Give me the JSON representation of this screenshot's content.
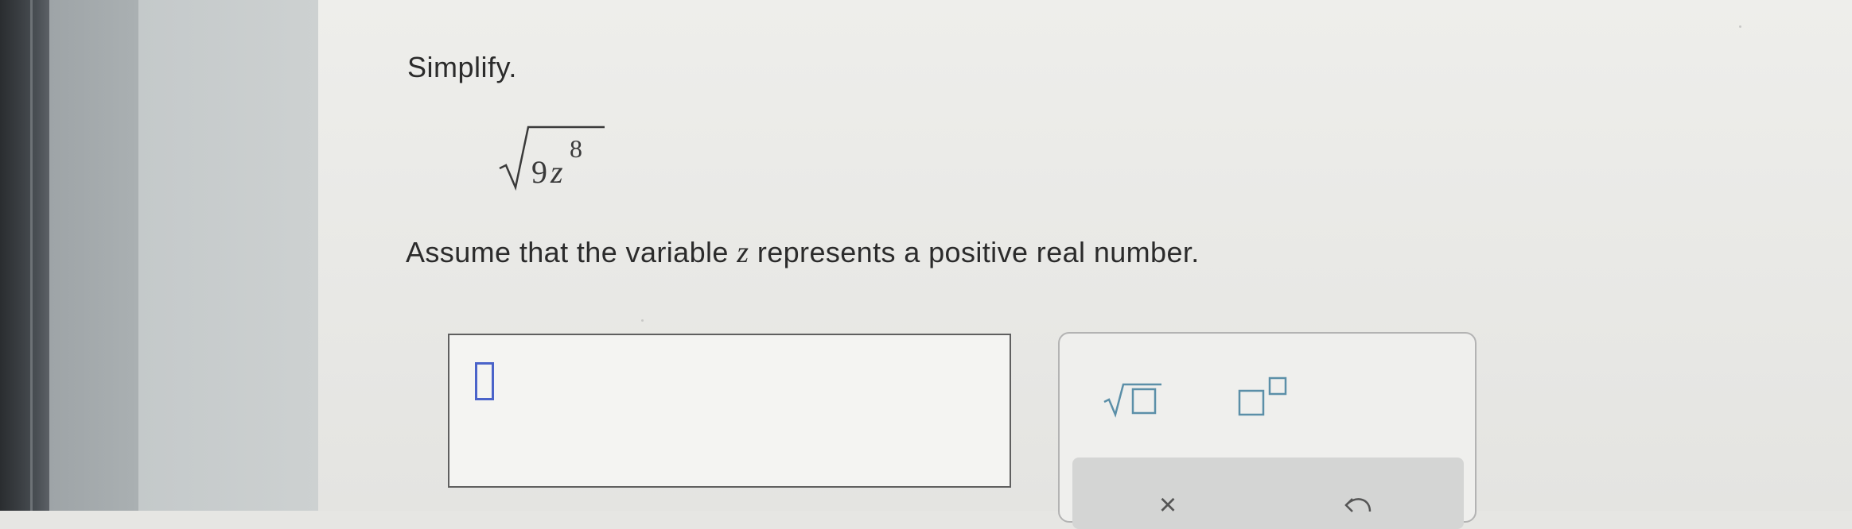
{
  "question": {
    "instruction": "Simplify.",
    "expression": {
      "radicand_coefficient": "9",
      "radicand_variable": "z",
      "exponent": "8"
    },
    "assumption_before": "Assume that the variable ",
    "assumption_variable": "z",
    "assumption_after": " represents a positive real number."
  },
  "answer": {
    "value": ""
  },
  "toolbar": {
    "sqrt_icon": "square-root-template-icon",
    "exponent_icon": "exponent-template-icon",
    "clear_symbol": "×",
    "undo_icon": "undo-icon"
  },
  "colors": {
    "cursor_slot": "#4a63c9",
    "tool_icon": "#5b8fa8",
    "panel_background": "#eeeeeb"
  }
}
